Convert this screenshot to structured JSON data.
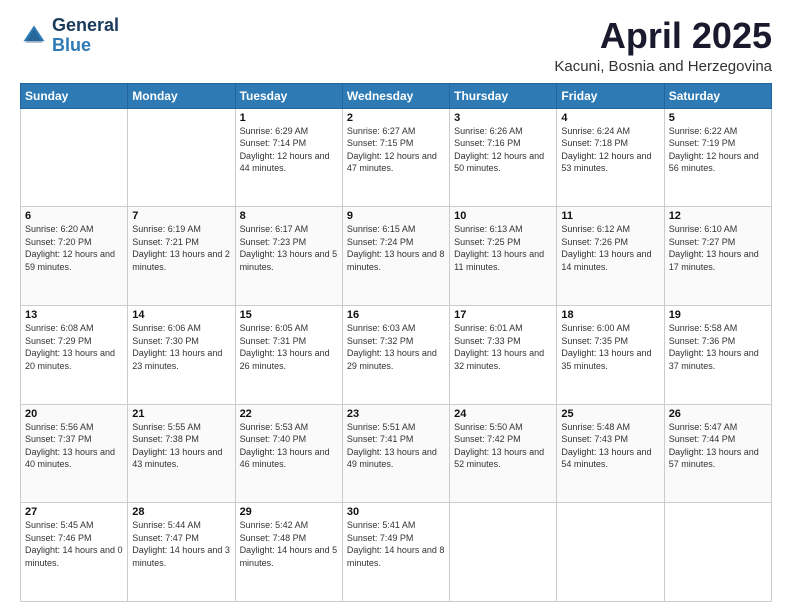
{
  "header": {
    "logo": {
      "general": "General",
      "blue": "Blue"
    },
    "title": "April 2025",
    "location": "Kacuni, Bosnia and Herzegovina"
  },
  "days_of_week": [
    "Sunday",
    "Monday",
    "Tuesday",
    "Wednesday",
    "Thursday",
    "Friday",
    "Saturday"
  ],
  "weeks": [
    [
      {
        "day": "",
        "sunrise": "",
        "sunset": "",
        "daylight": ""
      },
      {
        "day": "",
        "sunrise": "",
        "sunset": "",
        "daylight": ""
      },
      {
        "day": "1",
        "sunrise": "Sunrise: 6:29 AM",
        "sunset": "Sunset: 7:14 PM",
        "daylight": "Daylight: 12 hours and 44 minutes."
      },
      {
        "day": "2",
        "sunrise": "Sunrise: 6:27 AM",
        "sunset": "Sunset: 7:15 PM",
        "daylight": "Daylight: 12 hours and 47 minutes."
      },
      {
        "day": "3",
        "sunrise": "Sunrise: 6:26 AM",
        "sunset": "Sunset: 7:16 PM",
        "daylight": "Daylight: 12 hours and 50 minutes."
      },
      {
        "day": "4",
        "sunrise": "Sunrise: 6:24 AM",
        "sunset": "Sunset: 7:18 PM",
        "daylight": "Daylight: 12 hours and 53 minutes."
      },
      {
        "day": "5",
        "sunrise": "Sunrise: 6:22 AM",
        "sunset": "Sunset: 7:19 PM",
        "daylight": "Daylight: 12 hours and 56 minutes."
      }
    ],
    [
      {
        "day": "6",
        "sunrise": "Sunrise: 6:20 AM",
        "sunset": "Sunset: 7:20 PM",
        "daylight": "Daylight: 12 hours and 59 minutes."
      },
      {
        "day": "7",
        "sunrise": "Sunrise: 6:19 AM",
        "sunset": "Sunset: 7:21 PM",
        "daylight": "Daylight: 13 hours and 2 minutes."
      },
      {
        "day": "8",
        "sunrise": "Sunrise: 6:17 AM",
        "sunset": "Sunset: 7:23 PM",
        "daylight": "Daylight: 13 hours and 5 minutes."
      },
      {
        "day": "9",
        "sunrise": "Sunrise: 6:15 AM",
        "sunset": "Sunset: 7:24 PM",
        "daylight": "Daylight: 13 hours and 8 minutes."
      },
      {
        "day": "10",
        "sunrise": "Sunrise: 6:13 AM",
        "sunset": "Sunset: 7:25 PM",
        "daylight": "Daylight: 13 hours and 11 minutes."
      },
      {
        "day": "11",
        "sunrise": "Sunrise: 6:12 AM",
        "sunset": "Sunset: 7:26 PM",
        "daylight": "Daylight: 13 hours and 14 minutes."
      },
      {
        "day": "12",
        "sunrise": "Sunrise: 6:10 AM",
        "sunset": "Sunset: 7:27 PM",
        "daylight": "Daylight: 13 hours and 17 minutes."
      }
    ],
    [
      {
        "day": "13",
        "sunrise": "Sunrise: 6:08 AM",
        "sunset": "Sunset: 7:29 PM",
        "daylight": "Daylight: 13 hours and 20 minutes."
      },
      {
        "day": "14",
        "sunrise": "Sunrise: 6:06 AM",
        "sunset": "Sunset: 7:30 PM",
        "daylight": "Daylight: 13 hours and 23 minutes."
      },
      {
        "day": "15",
        "sunrise": "Sunrise: 6:05 AM",
        "sunset": "Sunset: 7:31 PM",
        "daylight": "Daylight: 13 hours and 26 minutes."
      },
      {
        "day": "16",
        "sunrise": "Sunrise: 6:03 AM",
        "sunset": "Sunset: 7:32 PM",
        "daylight": "Daylight: 13 hours and 29 minutes."
      },
      {
        "day": "17",
        "sunrise": "Sunrise: 6:01 AM",
        "sunset": "Sunset: 7:33 PM",
        "daylight": "Daylight: 13 hours and 32 minutes."
      },
      {
        "day": "18",
        "sunrise": "Sunrise: 6:00 AM",
        "sunset": "Sunset: 7:35 PM",
        "daylight": "Daylight: 13 hours and 35 minutes."
      },
      {
        "day": "19",
        "sunrise": "Sunrise: 5:58 AM",
        "sunset": "Sunset: 7:36 PM",
        "daylight": "Daylight: 13 hours and 37 minutes."
      }
    ],
    [
      {
        "day": "20",
        "sunrise": "Sunrise: 5:56 AM",
        "sunset": "Sunset: 7:37 PM",
        "daylight": "Daylight: 13 hours and 40 minutes."
      },
      {
        "day": "21",
        "sunrise": "Sunrise: 5:55 AM",
        "sunset": "Sunset: 7:38 PM",
        "daylight": "Daylight: 13 hours and 43 minutes."
      },
      {
        "day": "22",
        "sunrise": "Sunrise: 5:53 AM",
        "sunset": "Sunset: 7:40 PM",
        "daylight": "Daylight: 13 hours and 46 minutes."
      },
      {
        "day": "23",
        "sunrise": "Sunrise: 5:51 AM",
        "sunset": "Sunset: 7:41 PM",
        "daylight": "Daylight: 13 hours and 49 minutes."
      },
      {
        "day": "24",
        "sunrise": "Sunrise: 5:50 AM",
        "sunset": "Sunset: 7:42 PM",
        "daylight": "Daylight: 13 hours and 52 minutes."
      },
      {
        "day": "25",
        "sunrise": "Sunrise: 5:48 AM",
        "sunset": "Sunset: 7:43 PM",
        "daylight": "Daylight: 13 hours and 54 minutes."
      },
      {
        "day": "26",
        "sunrise": "Sunrise: 5:47 AM",
        "sunset": "Sunset: 7:44 PM",
        "daylight": "Daylight: 13 hours and 57 minutes."
      }
    ],
    [
      {
        "day": "27",
        "sunrise": "Sunrise: 5:45 AM",
        "sunset": "Sunset: 7:46 PM",
        "daylight": "Daylight: 14 hours and 0 minutes."
      },
      {
        "day": "28",
        "sunrise": "Sunrise: 5:44 AM",
        "sunset": "Sunset: 7:47 PM",
        "daylight": "Daylight: 14 hours and 3 minutes."
      },
      {
        "day": "29",
        "sunrise": "Sunrise: 5:42 AM",
        "sunset": "Sunset: 7:48 PM",
        "daylight": "Daylight: 14 hours and 5 minutes."
      },
      {
        "day": "30",
        "sunrise": "Sunrise: 5:41 AM",
        "sunset": "Sunset: 7:49 PM",
        "daylight": "Daylight: 14 hours and 8 minutes."
      },
      {
        "day": "",
        "sunrise": "",
        "sunset": "",
        "daylight": ""
      },
      {
        "day": "",
        "sunrise": "",
        "sunset": "",
        "daylight": ""
      },
      {
        "day": "",
        "sunrise": "",
        "sunset": "",
        "daylight": ""
      }
    ]
  ]
}
